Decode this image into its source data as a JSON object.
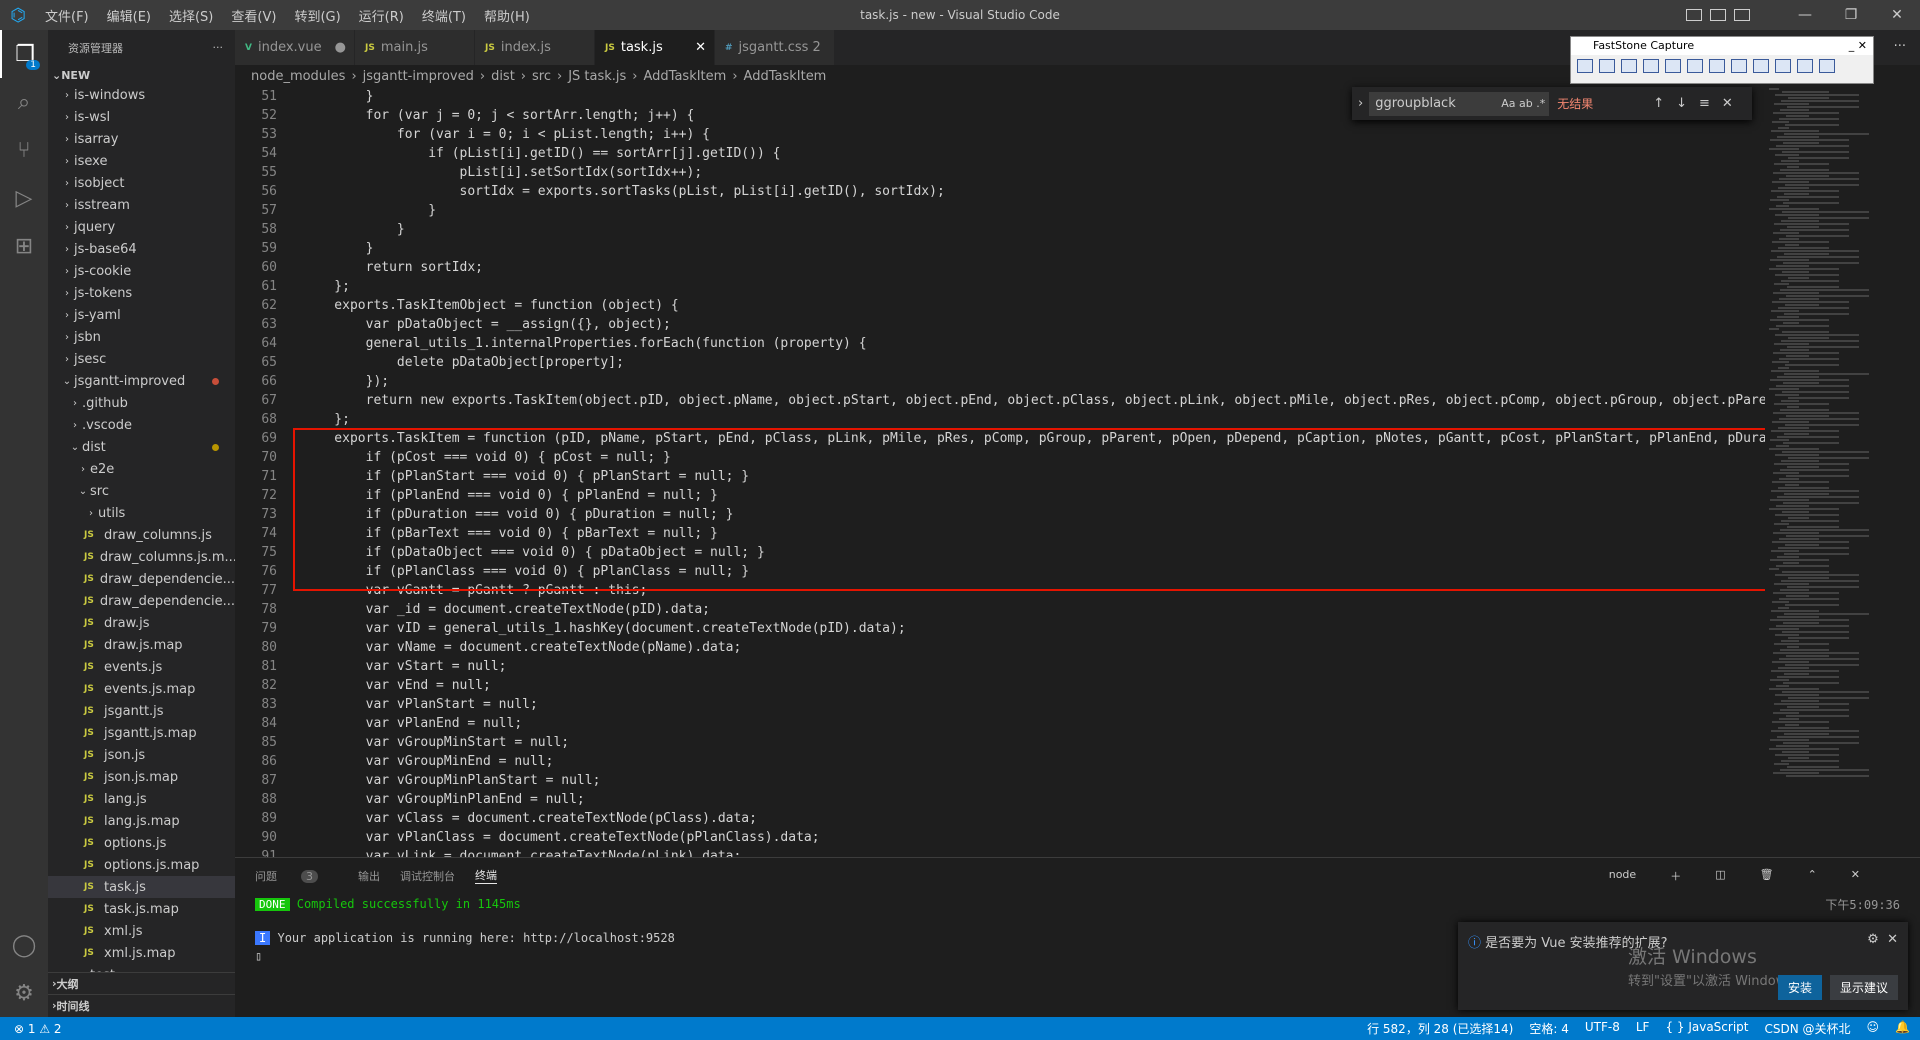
{
  "window": {
    "title": "task.js - new - Visual Studio Code",
    "menu": [
      "文件(F)",
      "编辑(E)",
      "选择(S)",
      "查看(V)",
      "转到(G)",
      "运行(R)",
      "终端(T)",
      "帮助(H)"
    ]
  },
  "sidebar": {
    "header": "资源管理器",
    "section": "NEW",
    "items": [
      {
        "label": "is-windows",
        "depth": 1,
        "type": "folder"
      },
      {
        "label": "is-wsl",
        "depth": 1,
        "type": "folder"
      },
      {
        "label": "isarray",
        "depth": 1,
        "type": "folder"
      },
      {
        "label": "isexe",
        "depth": 1,
        "type": "folder"
      },
      {
        "label": "isobject",
        "depth": 1,
        "type": "folder"
      },
      {
        "label": "isstream",
        "depth": 1,
        "type": "folder"
      },
      {
        "label": "jquery",
        "depth": 1,
        "type": "folder"
      },
      {
        "label": "js-base64",
        "depth": 1,
        "type": "folder"
      },
      {
        "label": "js-cookie",
        "depth": 1,
        "type": "folder"
      },
      {
        "label": "js-tokens",
        "depth": 1,
        "type": "folder"
      },
      {
        "label": "js-yaml",
        "depth": 1,
        "type": "folder"
      },
      {
        "label": "jsbn",
        "depth": 1,
        "type": "folder"
      },
      {
        "label": "jsesc",
        "depth": 1,
        "type": "folder"
      },
      {
        "label": "jsgantt-improved",
        "depth": 1,
        "type": "folder-open",
        "dot": "#c74e39"
      },
      {
        "label": ".github",
        "depth": 2,
        "type": "folder"
      },
      {
        "label": ".vscode",
        "depth": 2,
        "type": "folder"
      },
      {
        "label": "dist",
        "depth": 2,
        "type": "folder-open",
        "dot": "#b89500"
      },
      {
        "label": "e2e",
        "depth": 3,
        "type": "folder"
      },
      {
        "label": "src",
        "depth": 3,
        "type": "folder-open"
      },
      {
        "label": "utils",
        "depth": 4,
        "type": "folder"
      },
      {
        "label": "draw_columns.js",
        "depth": 4,
        "type": "js"
      },
      {
        "label": "draw_columns.js.m...",
        "depth": 4,
        "type": "js"
      },
      {
        "label": "draw_dependencie...",
        "depth": 4,
        "type": "js"
      },
      {
        "label": "draw_dependencie...",
        "depth": 4,
        "type": "js"
      },
      {
        "label": "draw.js",
        "depth": 4,
        "type": "js"
      },
      {
        "label": "draw.js.map",
        "depth": 4,
        "type": "js"
      },
      {
        "label": "events.js",
        "depth": 4,
        "type": "js"
      },
      {
        "label": "events.js.map",
        "depth": 4,
        "type": "js"
      },
      {
        "label": "jsgantt.js",
        "depth": 4,
        "type": "js"
      },
      {
        "label": "jsgantt.js.map",
        "depth": 4,
        "type": "js"
      },
      {
        "label": "json.js",
        "depth": 4,
        "type": "js"
      },
      {
        "label": "json.js.map",
        "depth": 4,
        "type": "js"
      },
      {
        "label": "lang.js",
        "depth": 4,
        "type": "js"
      },
      {
        "label": "lang.js.map",
        "depth": 4,
        "type": "js"
      },
      {
        "label": "options.js",
        "depth": 4,
        "type": "js"
      },
      {
        "label": "options.js.map",
        "depth": 4,
        "type": "js"
      },
      {
        "label": "task.js",
        "depth": 4,
        "type": "js",
        "selected": true
      },
      {
        "label": "task.js.map",
        "depth": 4,
        "type": "js"
      },
      {
        "label": "xml.js",
        "depth": 4,
        "type": "js"
      },
      {
        "label": "xml.js.map",
        "depth": 4,
        "type": "js"
      },
      {
        "label": "test",
        "depth": 3,
        "type": "folder"
      }
    ],
    "outline": "大纲",
    "timeline": "时间线"
  },
  "tabs": [
    {
      "icon": "V",
      "label": "index.vue",
      "mark": "●",
      "color": "#41b883"
    },
    {
      "icon": "JS",
      "label": "main.js",
      "color": "#cbcb41"
    },
    {
      "icon": "JS",
      "label": "index.js",
      "color": "#cbcb41"
    },
    {
      "icon": "JS",
      "label": "task.js",
      "active": true,
      "mark": "✕",
      "color": "#cbcb41"
    },
    {
      "icon": "#",
      "label": "jsgantt.css 2",
      "color": "#519aba"
    }
  ],
  "breadcrumb": [
    "node_modules",
    "›",
    "jsgantt-improved",
    "›",
    "dist",
    "›",
    "src",
    "›",
    "JS task.js",
    "›",
    "AddTaskItem",
    "›",
    "AddTaskItem"
  ],
  "find": {
    "value": "ggroupblack",
    "opts": "Aa ab .*",
    "result": "无结果"
  },
  "code": [
    [
      51,
      "        }"
    ],
    [
      52,
      "        for (var j = 0; j < sortArr.length; j++) {"
    ],
    [
      53,
      "            for (var i = 0; i < pList.length; i++) {"
    ],
    [
      54,
      "                if (pList[i].getID() == sortArr[j].getID()) {"
    ],
    [
      55,
      "                    pList[i].setSortIdx(sortIdx++);"
    ],
    [
      56,
      "                    sortIdx = exports.sortTasks(pList, pList[i].getID(), sortIdx);"
    ],
    [
      57,
      "                }"
    ],
    [
      58,
      "            }"
    ],
    [
      59,
      "        }"
    ],
    [
      60,
      "        return sortIdx;"
    ],
    [
      61,
      "    };"
    ],
    [
      62,
      "    exports.TaskItemObject = function (object) {"
    ],
    [
      63,
      "        var pDataObject = __assign({}, object);"
    ],
    [
      64,
      "        general_utils_1.internalProperties.forEach(function (property) {"
    ],
    [
      65,
      "            delete pDataObject[property];"
    ],
    [
      66,
      "        });"
    ],
    [
      67,
      "        return new exports.TaskItem(object.pID, object.pName, object.pStart, object.pEnd, object.pClass, object.pLink, object.pMile, object.pRes, object.pComp, object.pGroup, object.pParent, object"
    ],
    [
      68,
      "    };"
    ],
    [
      69,
      "    exports.TaskItem = function (pID, pName, pStart, pEnd, pClass, pLink, pMile, pRes, pComp, pGroup, pParent, pOpen, pDepend, pCaption, pNotes, pGantt, pCost, pPlanStart, pPlanEnd, pDuration, pBar"
    ],
    [
      70,
      "        if (pCost === void 0) { pCost = null; }"
    ],
    [
      71,
      "        if (pPlanStart === void 0) { pPlanStart = null; }"
    ],
    [
      72,
      "        if (pPlanEnd === void 0) { pPlanEnd = null; }"
    ],
    [
      73,
      "        if (pDuration === void 0) { pDuration = null; }"
    ],
    [
      74,
      "        if (pBarText === void 0) { pBarText = null; }"
    ],
    [
      75,
      "        if (pDataObject === void 0) { pDataObject = null; }"
    ],
    [
      76,
      "        if (pPlanClass === void 0) { pPlanClass = null; }"
    ],
    [
      77,
      "        var vGantt = pGantt ? pGantt : this;"
    ],
    [
      78,
      "        var _id = document.createTextNode(pID).data;"
    ],
    [
      79,
      "        var vID = general_utils_1.hashKey(document.createTextNode(pID).data);"
    ],
    [
      80,
      "        var vName = document.createTextNode(pName).data;"
    ],
    [
      81,
      "        var vStart = null;"
    ],
    [
      82,
      "        var vEnd = null;"
    ],
    [
      83,
      "        var vPlanStart = null;"
    ],
    [
      84,
      "        var vPlanEnd = null;"
    ],
    [
      85,
      "        var vGroupMinStart = null;"
    ],
    [
      86,
      "        var vGroupMinEnd = null;"
    ],
    [
      87,
      "        var vGroupMinPlanStart = null;"
    ],
    [
      88,
      "        var vGroupMinPlanEnd = null;"
    ],
    [
      89,
      "        var vClass = document.createTextNode(pClass).data;"
    ],
    [
      90,
      "        var vPlanClass = document.createTextNode(pPlanClass).data;"
    ],
    [
      91,
      "        var vLink = document.createTextNode(pLink).data;"
    ]
  ],
  "fastcapture": {
    "title": "FastStone Capture"
  },
  "panel": {
    "tabs": [
      "问题",
      "输出",
      "调试控制台",
      "终端"
    ],
    "problems_count": "3",
    "terminal_name": "node",
    "done_label": "DONE",
    "done_text": "Compiled successfully in 1145ms",
    "time": "下午5:09:36",
    "info_label": "I",
    "info_text": "Your application is running here: http://localhost:9528"
  },
  "notification": {
    "text": "是否要为 Vue 安装推荐的扩展?",
    "install": "安装",
    "show": "显示建议",
    "watermark1": "激活 Windows",
    "watermark2": "转到\"设置\"以激活 Windows。"
  },
  "status": {
    "errors": "⊗ 1 ⚠ 2",
    "position": "行 582，列 28 (已选择14)",
    "spaces": "空格: 4",
    "encoding": "UTF-8",
    "eol": "LF",
    "lang": "{ } JavaScript",
    "credit": "CSDN @关杯北"
  }
}
